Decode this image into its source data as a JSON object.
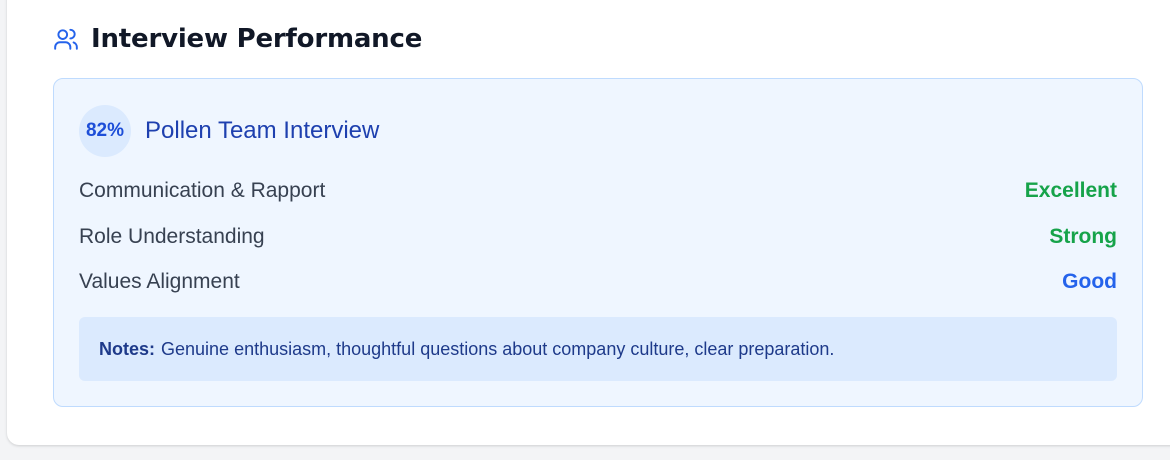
{
  "section": {
    "title": "Interview Performance",
    "icon": "users-icon"
  },
  "interview": {
    "score": "82%",
    "title": "Pollen Team Interview",
    "metrics": [
      {
        "label": "Communication & Rapport",
        "value": "Excellent",
        "color": "#16a34a"
      },
      {
        "label": "Role Understanding",
        "value": "Strong",
        "color": "#16a34a"
      },
      {
        "label": "Values Alignment",
        "value": "Good",
        "color": "#2563eb"
      }
    ],
    "notes_label": "Notes:",
    "notes_text": "Genuine enthusiasm, thoughtful questions about company culture, clear preparation."
  },
  "colors": {
    "accent": "#2563eb",
    "panel_bg": "#eff6ff",
    "panel_border": "#bfdbfe",
    "notes_bg": "#dbeafe"
  }
}
